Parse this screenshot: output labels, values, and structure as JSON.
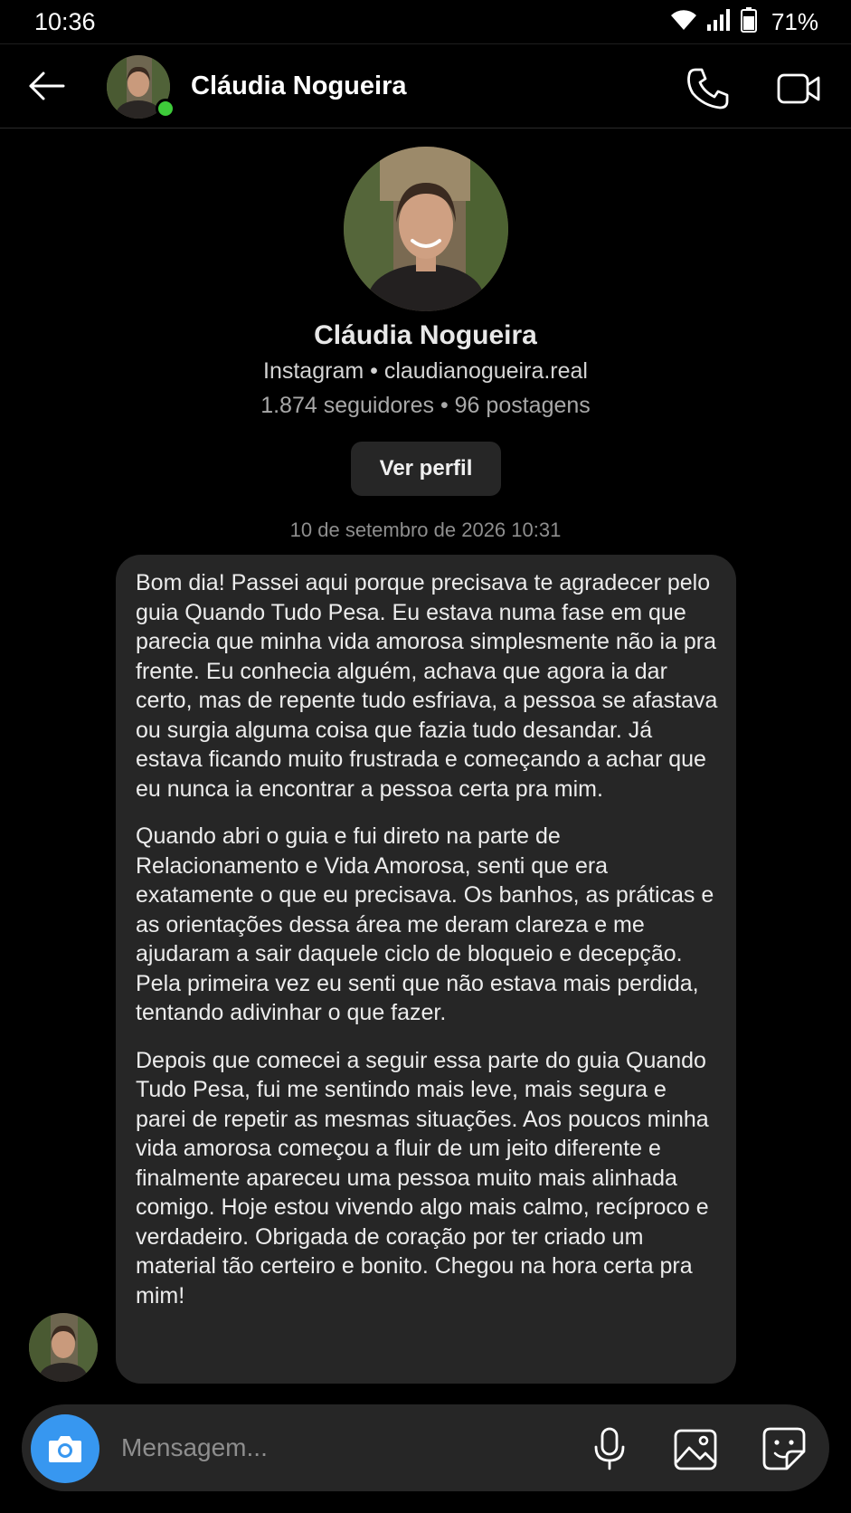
{
  "status_bar": {
    "time": "10:36",
    "battery": "71%",
    "icons": [
      "wifi-icon",
      "signal-icon",
      "battery-icon"
    ]
  },
  "header": {
    "contact_name": "Cláudia Nogueira",
    "online": true,
    "icons": [
      "back-arrow-icon",
      "phone-icon",
      "video-camera-icon"
    ]
  },
  "profile": {
    "name": "Cláudia Nogueira",
    "source_line": "Instagram • claudianogueira.real",
    "stats_line": "1.874 seguidores • 96 postagens",
    "view_profile_label": "Ver perfil"
  },
  "conversation": {
    "timestamp": "10 de setembro de 2026 10:31",
    "message": {
      "paragraphs": [
        "Bom dia! Passei aqui porque precisava te agradecer pelo guia Quando Tudo Pesa. Eu estava numa fase em que parecia que minha vida amorosa simplesmente não ia pra frente. Eu conhecia alguém, achava que agora ia dar certo, mas de repente tudo esfriava, a pessoa se afastava ou surgia alguma coisa que fazia tudo desandar. Já estava ficando muito frustrada e começando a achar que eu nunca ia encontrar a pessoa certa pra mim.",
        "Quando abri o guia e fui direto na parte de Relacionamento e Vida Amorosa, senti que era exatamente o que eu precisava. Os banhos, as práticas e as orientações dessa área me deram clareza e me ajudaram a sair daquele ciclo de bloqueio e decepção. Pela primeira vez eu senti que não estava mais perdida, tentando adivinhar o que fazer.",
        "Depois que comecei a seguir essa parte do guia Quando Tudo Pesa, fui me sentindo mais leve, mais segura e parei de repetir as mesmas situações. Aos poucos minha vida amorosa começou a fluir de um jeito diferente e finalmente apareceu uma pessoa muito mais alinhada comigo. Hoje estou vivendo algo mais calmo, recíproco e verdadeiro. Obrigada de coração por ter criado um material tão certeiro e bonito. Chegou na hora certa pra mim!"
      ]
    }
  },
  "composer": {
    "placeholder": "Mensagem...",
    "icons": [
      "camera-icon",
      "microphone-icon",
      "gallery-icon",
      "sticker-icon"
    ]
  },
  "colors": {
    "background": "#000000",
    "bubble": "#262626",
    "accent": "#3797f0",
    "online": "#3ecb3a"
  }
}
